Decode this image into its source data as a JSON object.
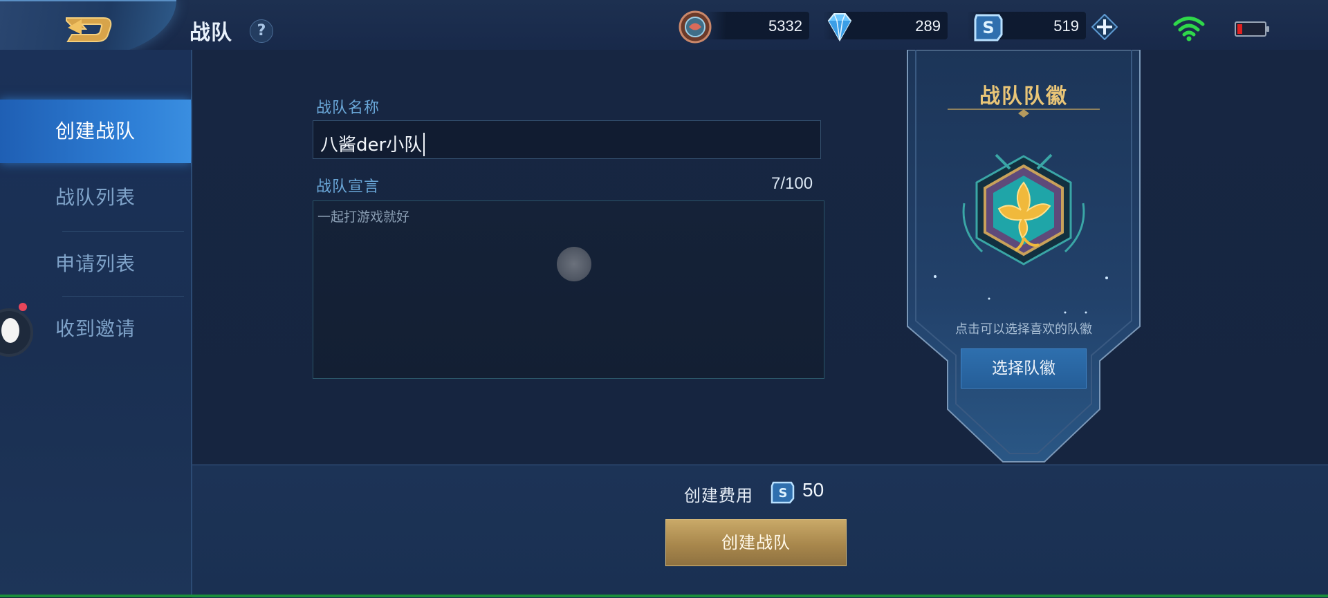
{
  "header": {
    "title": "战队",
    "back_icon": "back-arrow-icon",
    "help_symbol": "?",
    "currencies": [
      {
        "icon": "gold-coin-icon",
        "value": "5332"
      },
      {
        "icon": "diamond-icon",
        "value": "289"
      },
      {
        "icon": "voucher-icon",
        "value": "519"
      }
    ],
    "add_icon": "plus-icon",
    "wifi_color": "#2fd84a",
    "battery_color": "#e02020"
  },
  "sidebar": {
    "items": [
      {
        "label": "创建战队",
        "active": true
      },
      {
        "label": "战队列表",
        "active": false
      },
      {
        "label": "申请列表",
        "active": false
      },
      {
        "label": "收到邀请",
        "active": false
      }
    ]
  },
  "form": {
    "name_label": "战队名称",
    "name_value": "八酱der小队",
    "manifesto_label": "战队宣言",
    "manifesto_counter": "7/100",
    "manifesto_value": "一起打游戏就好"
  },
  "emblem": {
    "title": "战队队徽",
    "hint": "点击可以选择喜欢的队徽",
    "button_label": "选择队徽"
  },
  "footer": {
    "cost_label": "创建费用",
    "cost_icon": "voucher-icon",
    "cost_value": "50",
    "create_button_label": "创建战队"
  },
  "colors": {
    "accent_gold": "#e9c577",
    "accent_blue": "#2e7fd6",
    "create_button": "#a8874c"
  }
}
